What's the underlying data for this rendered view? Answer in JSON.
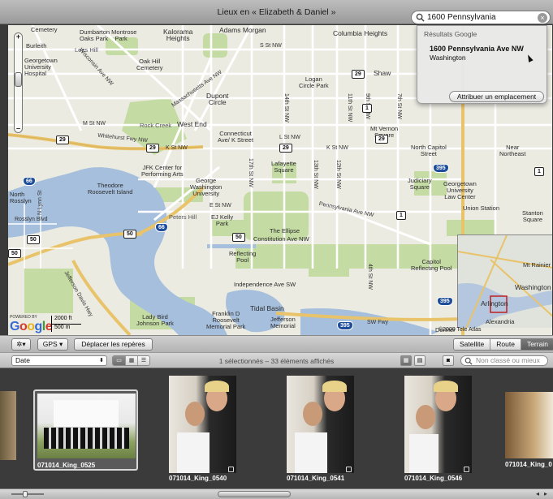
{
  "window": {
    "title": "Lieux en « Elizabeth & Daniel »"
  },
  "map_search": {
    "value": "1600 Pennsylvania"
  },
  "search_results": {
    "header": "Résultats Google",
    "result_title": "1600 Pennsylvania Ave NW",
    "result_subtitle": "Washington",
    "assign_label": "Attribuer un emplacement"
  },
  "map": {
    "labels": {
      "cemetery": "Cemetery",
      "burleith": "Burleith",
      "georgetown": "Georgetown\nUniversity\nHospital",
      "dumbarton": "Dumbarton Montrose\nOaks Park    Park",
      "kalorama": "Kalorama\nHeights",
      "adams": "Adams Morgan",
      "columbia": "Columbia Heights",
      "lees": "Lees Hill",
      "oakhill": "Oak Hill\nCemetery",
      "dupont": "Dupont\nCircle",
      "logan": "Logan\nCircle Park",
      "shaw": "Shaw",
      "rockcreek": "Rock Creek",
      "westend": "West End",
      "connecticut": "Connecticut\nAve/ K Street",
      "mtvernon": "Mt Vernon\nSquare",
      "northcapitol": "North Capitol\nStreet",
      "near": "Near\nNortheast",
      "theodore": "Theodore\nRoosevelt Island",
      "jfk": "JFK Center for\nPerforming Arts",
      "gwu": "George\nWashington\nUniversity",
      "lafayette": "Lafayette\nSquare",
      "judiciary": "Judiciary\nSquare",
      "gulaw": "Georgetown\nUniversity\nLaw Center",
      "union": "Union Station",
      "stanton": "Stanton\nSquare",
      "north_rosslyn": "North\nRosslyn",
      "petershill": "Peters Hill",
      "ejkelly": "EJ Kelly\nPark",
      "ellipse": "The Ellipse",
      "constitution": "Constitution Ave NW",
      "reflecting": "Reflecting\nPool",
      "capitolpool": "Capitol\nReflecting Pool",
      "independence": "Independence Ave SW",
      "tidal": "Tidal Basin",
      "ladybird": "Lady Bird\nJohnson Park",
      "franklin": "Franklin D\nRoosevelt\nMemorial Park",
      "jefferson": "Jefferson\nMemorial",
      "arlington": "Arlington",
      "washington": "Washington",
      "alexandria": "Alexandria",
      "mtrainier": "Mt Rainier",
      "donner": "Donner",
      "k_st": "K St NW",
      "k_st2": "K St NW",
      "m_st": "M St NW",
      "l_st": "L St NW",
      "e_st": "E St NW",
      "s_st": "S St NW",
      "whitehurst": "Whitehurst Fwy NW",
      "penn": "Pennsylvania Ave NW",
      "sw_fwy": "SW Fwy",
      "rhode": "Rhode Island Ave NW",
      "massave": "Massachusetts Ave NW",
      "rockcreekpkwy": "Rock Creek Pkwy NW",
      "jeff_davis": "Jefferson Davis Hwy",
      "gw_pkwy": "George Washington Pkwy",
      "fort_myer": "Fort Myer Dr",
      "wisconsin": "Wisconsin Ave NW",
      "n_lynn": "N Lynn St",
      "rosslyn_blvd": "Rosslyn Blvd",
      "st_17": "17th St NW",
      "st_11": "11th St NW",
      "st_12": "12th St NW",
      "st_13": "13th St NW",
      "st_14": "14th St NW",
      "st_9": "9th St NW",
      "st_7": "7th St NW",
      "st_4": "4th St NW"
    },
    "scale_top": "2000 ft",
    "scale_bottom": "500 m",
    "powered_by": "POWERED BY",
    "google": [
      "G",
      "o",
      "o",
      "g",
      "l",
      "e"
    ],
    "copyright": "©2009 Tele Atlas"
  },
  "map_toolbar": {
    "gps_label": "GPS",
    "move_pins_label": "Déplacer les repères",
    "map_types": [
      "Satellite",
      "Route",
      "Terrain"
    ],
    "selected_map_type": "Terrain"
  },
  "browser_toolbar": {
    "sort_value": "Date",
    "count_text": "1 sélectionnés – 33 éléments affichés",
    "filter_placeholder": "Non classé ou mieux"
  },
  "photos": [
    {
      "name": "",
      "selected": false
    },
    {
      "name": "071014_King_0525",
      "selected": true
    },
    {
      "name": "071014_King_0540",
      "selected": false
    },
    {
      "name": "071014_King_0541",
      "selected": false
    },
    {
      "name": "071014_King_0546",
      "selected": false
    },
    {
      "name": "071014_King_0",
      "selected": false
    }
  ],
  "colors": {
    "water": "#a5bfdd",
    "park": "#c5dba4",
    "map_bg": "#ecebe2",
    "freeway": "#e8c36a",
    "selected_map_type": "#6a6a6a"
  }
}
